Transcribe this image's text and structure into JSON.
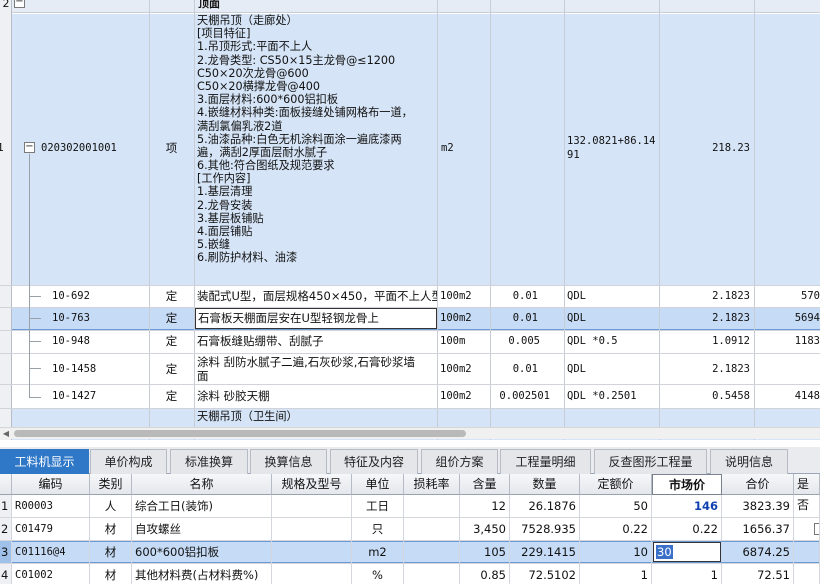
{
  "upper_grid": {
    "group_header": {
      "num": "2",
      "label": "顶面"
    },
    "main_item": {
      "row_num": "1",
      "code": "020302001001",
      "type": "项",
      "desc_lines": [
        "天棚吊顶（走廊处）",
        "[项目特征]",
        "1.吊顶形式:平面不上人",
        "2.龙骨类型: CS50×15主龙骨@≤1200",
        "C50×20次龙骨@600",
        "C50×20横撑龙骨@400",
        "3.面层材料:600*600铝扣板",
        "4.嵌缝材料种类:面板接缝处铺网格布一道，",
        "满刮氯偏乳液2道",
        "5.油漆品种:白色无机涂料面涂一遍底漆两",
        "遍，满刮2厚面层耐水腻子",
        "6.其他:符合图纸及规范要求",
        "[工作内容]",
        "1.基层清理",
        "2.龙骨安装",
        "3.基层板铺贴",
        "4.面层铺贴",
        "5.嵌缝",
        "6.刷防护材料、油漆"
      ],
      "unit": "m2",
      "formula_line1": "132.0821+86.14",
      "formula_line2": "91",
      "qty": "218.23"
    },
    "sub_items": [
      {
        "code": "10-692",
        "type": "定",
        "name": "装配式U型，面层规格450×450，平面不上人型",
        "unit": "100m2",
        "coef": "0.01",
        "expr": "QDL",
        "qty": "2.1823",
        "price": "570"
      },
      {
        "code": "10-763",
        "type": "定",
        "name": "石膏板天棚面层安在U型轻钢龙骨上",
        "unit": "100m2",
        "coef": "0.01",
        "expr": "QDL",
        "qty": "2.1823",
        "price": "5694"
      },
      {
        "code": "10-948",
        "type": "定",
        "name": "石膏板缝贴绷带、刮腻子",
        "unit": "100m",
        "coef": "0.005",
        "expr": "QDL *0.5",
        "qty": "1.0912",
        "price": "1183"
      },
      {
        "code": "10-1458",
        "type": "定",
        "name": "涂料 刮防水腻子二遍,石灰砂浆,石膏砂浆墙",
        "name2": "面",
        "unit": "100m2",
        "coef": "0.01",
        "expr": "QDL",
        "qty": "2.1823",
        "price": ""
      },
      {
        "code": "10-1427",
        "type": "定",
        "name": "涂料 砂胶天棚",
        "unit": "100m2",
        "coef": "0.002501",
        "expr": "QDL *0.2501",
        "qty": "0.5458",
        "price": "4148"
      }
    ],
    "next_item_desc": "天棚吊顶（卫生间）"
  },
  "tabs": [
    {
      "label": "工料机显示",
      "active": true
    },
    {
      "label": "单价构成"
    },
    {
      "label": "标准换算"
    },
    {
      "label": "换算信息"
    },
    {
      "label": "特征及内容"
    },
    {
      "label": "组价方案"
    },
    {
      "label": "工程量明细"
    },
    {
      "label": "反查图形工程量"
    },
    {
      "label": "说明信息"
    }
  ],
  "materials": {
    "headers": [
      "编码",
      "类别",
      "名称",
      "规格及型号",
      "单位",
      "损耗率",
      "含量",
      "数量",
      "定额价",
      "市场价",
      "合价",
      "是否"
    ],
    "rows": [
      {
        "num": "1",
        "code": "R00003",
        "cat": "人",
        "name": "综合工日(装饰)",
        "spec": "",
        "unit": "工日",
        "loss": "",
        "content": "12",
        "qty": "26.1876",
        "quota": "50",
        "market": "146",
        "total": "3823.39"
      },
      {
        "num": "2",
        "code": "C01479",
        "cat": "材",
        "name": "自攻螺丝",
        "spec": "",
        "unit": "只",
        "loss": "",
        "content": "3,450",
        "qty": "7528.935",
        "quota": "0.22",
        "market": "0.22",
        "total": "1656.37"
      },
      {
        "num": "3",
        "code": "C01116@4",
        "cat": "材",
        "name": "600*600铝扣板",
        "spec": "",
        "unit": "m2",
        "loss": "",
        "content": "105",
        "qty": "229.1415",
        "quota": "10",
        "market": "30",
        "total": "6874.25"
      },
      {
        "num": "4",
        "code": "C01002",
        "cat": "材",
        "name": "其他材料费(占材料费%)",
        "spec": "",
        "unit": "%",
        "loss": "",
        "content": "0.85",
        "qty": "72.5102",
        "quota": "1",
        "market": "1",
        "total": "72.51"
      }
    ]
  },
  "colors": {
    "selection": "#c6dbf5",
    "active_tab": "#2f78c8",
    "market_emphasis": "#1040b0"
  }
}
